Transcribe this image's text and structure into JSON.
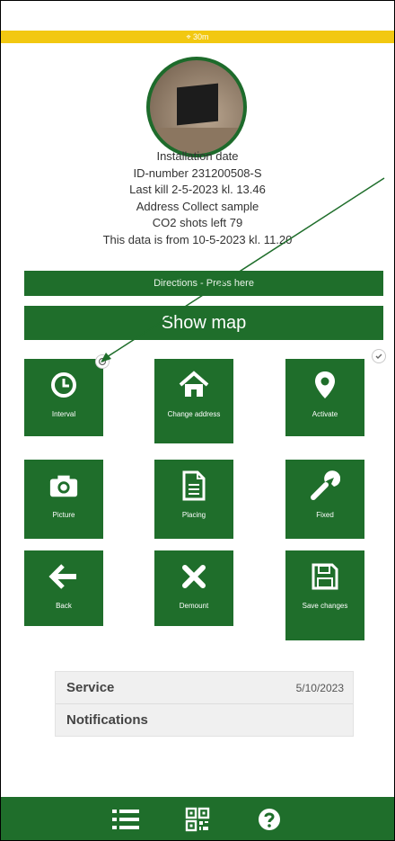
{
  "status_bar": {
    "text": "⌖ 30m"
  },
  "info": {
    "installation_date": "Installation date",
    "id_number": "ID-number 231200508-S",
    "last_kill": "Last kill 2-5-2023 kl. 13.46",
    "address": "Address Collect sample",
    "co2_shots": "CO2 shots left 79",
    "data_from": "This data is from 10-5-2023 kl. 11.20"
  },
  "buttons": {
    "directions": "Directions - Press here",
    "show_map": "Show map"
  },
  "tiles": [
    {
      "label": "Interval",
      "icon": "clock-icon"
    },
    {
      "label": "Change address",
      "icon": "home-icon"
    },
    {
      "label": "Activate",
      "icon": "map-pin-icon"
    },
    {
      "label": "Picture",
      "icon": "camera-icon"
    },
    {
      "label": "Placing",
      "icon": "document-icon"
    },
    {
      "label": "Fixed",
      "icon": "wrench-icon"
    },
    {
      "label": "Back",
      "icon": "arrow-left-icon"
    },
    {
      "label": "Demount",
      "icon": "x-icon"
    },
    {
      "label": "Save changes",
      "icon": "floppy-disk-icon"
    }
  ],
  "details": {
    "service_label": "Service",
    "service_value": "5/10/2023",
    "notifications_label": "Notifications"
  },
  "bottom_nav": {
    "items": [
      "list-icon",
      "qr-code-icon",
      "help-icon"
    ]
  },
  "colors": {
    "primary_green": "#1f6e2b",
    "status_yellow": "#f2c811"
  }
}
